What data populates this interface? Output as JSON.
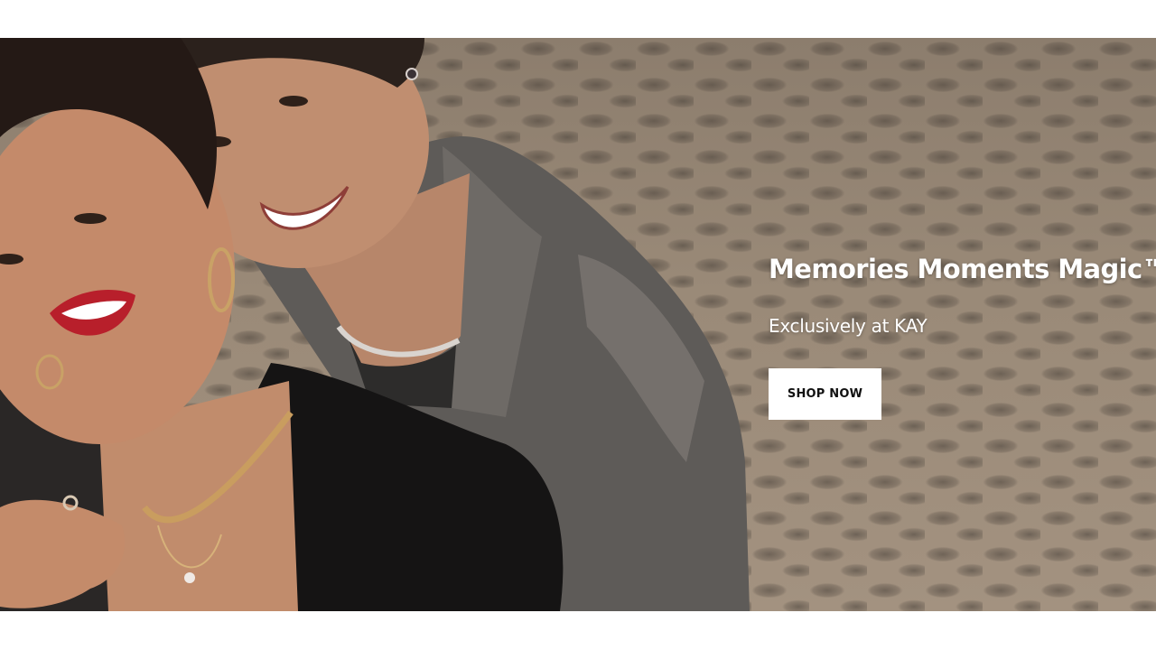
{
  "hero": {
    "title": "Memories Moments Magic™",
    "subtitle": "Exclusively at KAY",
    "cta_label": "SHOP NOW",
    "image": "couple-photo"
  },
  "colors": {
    "page_background": "#ffffff",
    "hero_text": "#ffffff",
    "button_background": "#ffffff",
    "button_text": "#111111"
  }
}
